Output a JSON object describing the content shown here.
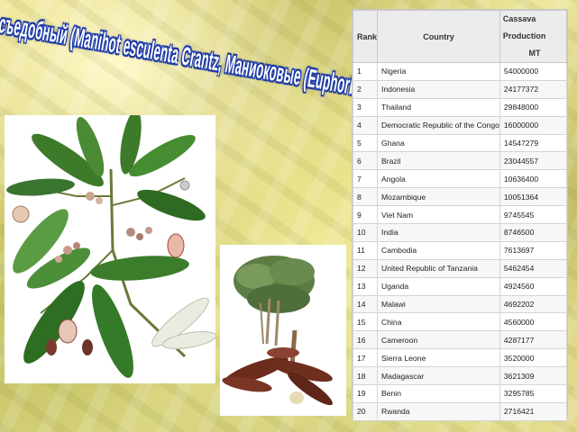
{
  "title": "Маниок съедобный (Manihot esculenta Crantz, Маниоковые (Euphorbiaceae))",
  "table": {
    "headers": {
      "rank": "Rank",
      "country": "Country",
      "production_line1": "Cassava Production",
      "production_line2": "MT"
    },
    "rows": [
      {
        "rank": "1",
        "country": "Nigeria",
        "production": "54000000"
      },
      {
        "rank": "2",
        "country": "Indonesia",
        "production": "24177372"
      },
      {
        "rank": "3",
        "country": "Thailand",
        "production": "29848000"
      },
      {
        "rank": "4",
        "country": "Democratic Republic of the Congo",
        "production": "16000000"
      },
      {
        "rank": "5",
        "country": "Ghana",
        "production": "14547279"
      },
      {
        "rank": "6",
        "country": "Brazil",
        "production": "23044557"
      },
      {
        "rank": "7",
        "country": "Angola",
        "production": "10636400"
      },
      {
        "rank": "8",
        "country": "Mozambique",
        "production": "10051364"
      },
      {
        "rank": "9",
        "country": "Viet Nam",
        "production": "9745545"
      },
      {
        "rank": "10",
        "country": "India",
        "production": "8746500"
      },
      {
        "rank": "11",
        "country": "Cambodia",
        "production": "7613697"
      },
      {
        "rank": "12",
        "country": "United Republic of Tanzania",
        "production": "5462454"
      },
      {
        "rank": "13",
        "country": "Uganda",
        "production": "4924560"
      },
      {
        "rank": "14",
        "country": "Malawi",
        "production": "4692202"
      },
      {
        "rank": "15",
        "country": "China",
        "production": "4560000"
      },
      {
        "rank": "16",
        "country": "Cameroon",
        "production": "4287177"
      },
      {
        "rank": "17",
        "country": "Sierra Leone",
        "production": "3520000"
      },
      {
        "rank": "18",
        "country": "Madagascar",
        "production": "3621309"
      },
      {
        "rank": "19",
        "country": "Benin",
        "production": "3295785"
      },
      {
        "rank": "20",
        "country": "Rwanda",
        "production": "2716421"
      }
    ]
  },
  "illustrations": {
    "plant_illustration_icon": "cassava-plant-botanical-illustration",
    "root_illustration_icon": "cassava-roots-illustration"
  },
  "colors": {
    "title_fill": "#ffffff",
    "title_outline": "#1e3aa8",
    "leaf_green": "#3d7a2a",
    "root_brown": "#6b2c1c"
  }
}
